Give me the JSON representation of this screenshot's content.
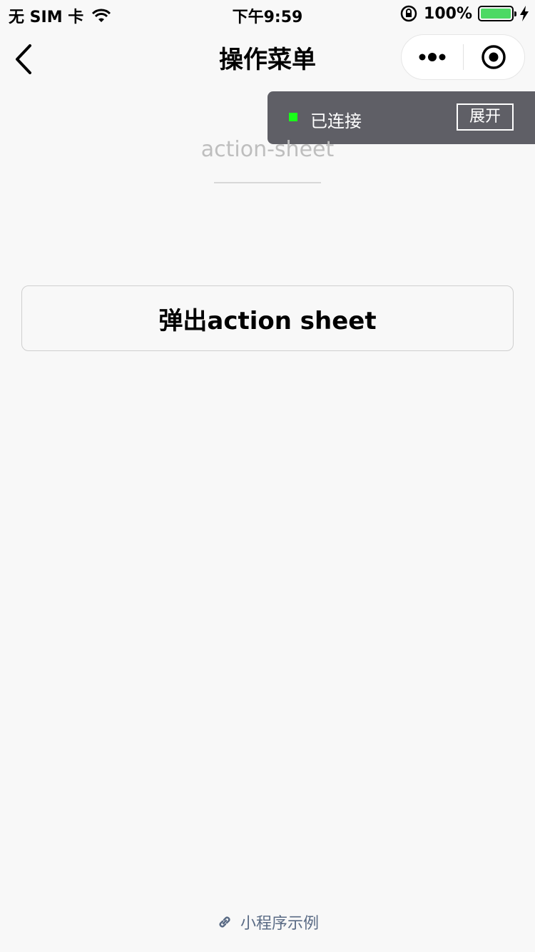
{
  "status_bar": {
    "carrier": "无 SIM 卡",
    "time": "下午9:59",
    "battery_percent": "100%",
    "battery_level": 1.0,
    "battery_color": "#4cd964"
  },
  "nav": {
    "title": "操作菜单",
    "back_icon": "chevron-left-icon",
    "more_icon": "more-dots-icon",
    "close_icon": "target-circle-icon"
  },
  "debug": {
    "status": "已连接",
    "status_color": "#19ff19",
    "expand_label": "展开"
  },
  "page": {
    "head_title": "action-sheet",
    "button_label": "弹出action sheet"
  },
  "footer": {
    "label": "小程序示例",
    "icon": "link-icon",
    "color": "#5a6b85"
  }
}
